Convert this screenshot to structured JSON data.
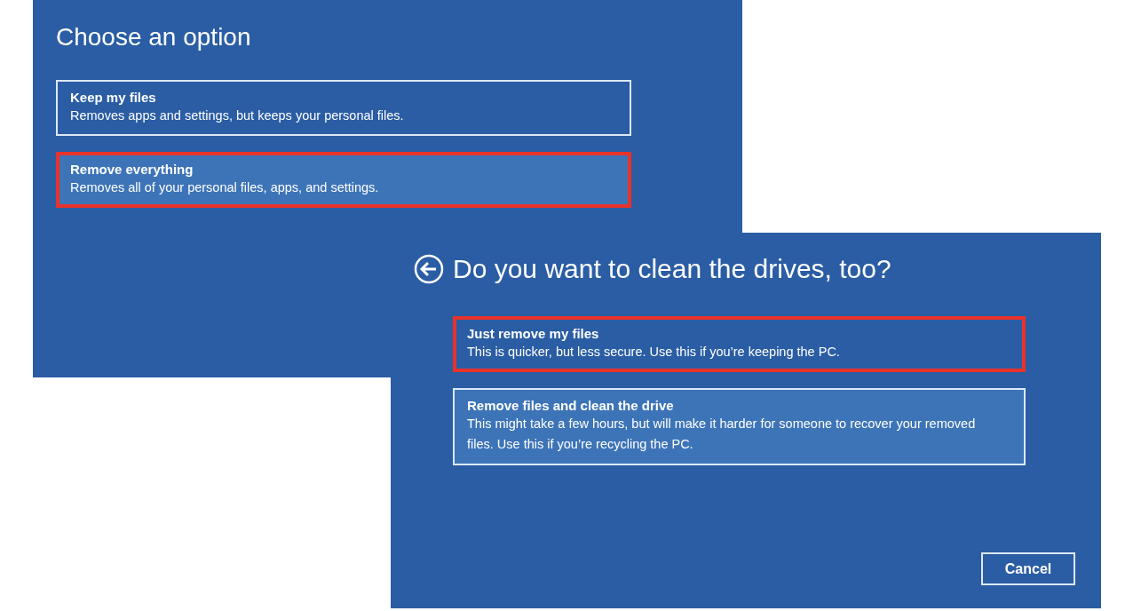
{
  "screens": [
    {
      "title": "Choose an option",
      "back_button": false,
      "options": [
        {
          "title": "Keep my files",
          "description": "Removes apps and settings, but keeps your personal files.",
          "focused": true,
          "highlighted": false,
          "marked": false
        },
        {
          "title": "Remove everything",
          "description": "Removes all of your personal files, apps, and settings.",
          "focused": false,
          "highlighted": true,
          "marked": true
        }
      ]
    },
    {
      "title": "Do you want to clean the drives, too?",
      "back_button": true,
      "options": [
        {
          "title": "Just remove my files",
          "description": "This is quicker, but less secure. Use this if you’re keeping the PC.",
          "focused": false,
          "highlighted": false,
          "marked": true
        },
        {
          "title": "Remove files and clean the drive",
          "description": "This might take a few hours, but will make it harder for someone to recover your removed files. Use this if you’re recycling the PC.",
          "focused": true,
          "highlighted": true,
          "marked": false
        }
      ],
      "buttons": [
        "Cancel"
      ]
    }
  ]
}
